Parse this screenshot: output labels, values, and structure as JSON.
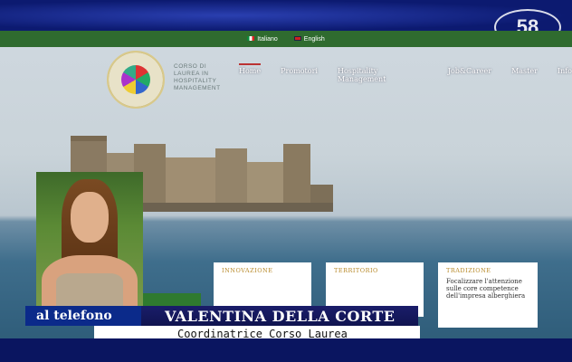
{
  "site": {
    "languages": [
      {
        "label": "Italiano",
        "flag": "it"
      },
      {
        "label": "English",
        "flag": "en"
      }
    ],
    "logo_text": [
      "CORSO DI",
      "LAUREA IN",
      "HOSPITALITY",
      "MANAGEMENT"
    ],
    "nav": [
      {
        "label": "Home",
        "active": true
      },
      {
        "label": "Promotori",
        "active": false
      },
      {
        "label": "Hospitality Management",
        "active": false
      },
      {
        "label": "Job&Career",
        "active": false
      },
      {
        "label": "Master",
        "active": false
      },
      {
        "label": "Info",
        "active": false
      }
    ],
    "cards": [
      {
        "title": "INNOVAZIONE",
        "text": ""
      },
      {
        "title": "TERRITORIO",
        "text": ""
      },
      {
        "title": "TRADIZIONE",
        "text": "Focalizzare l'attenzione sulle core competence dell'impresa alberghiera"
      }
    ]
  },
  "overlay": {
    "channel": "58",
    "phone_label": "al telefono",
    "name": "VALENTINA DELLA CORTE",
    "role": "Coordinatrice Corso Laurea"
  },
  "colors": {
    "lang_bar": "#2f6b2f",
    "label_blue": "#0b2a8a",
    "name_bar": "#1a1d6a",
    "nav_active": "#b33333"
  }
}
